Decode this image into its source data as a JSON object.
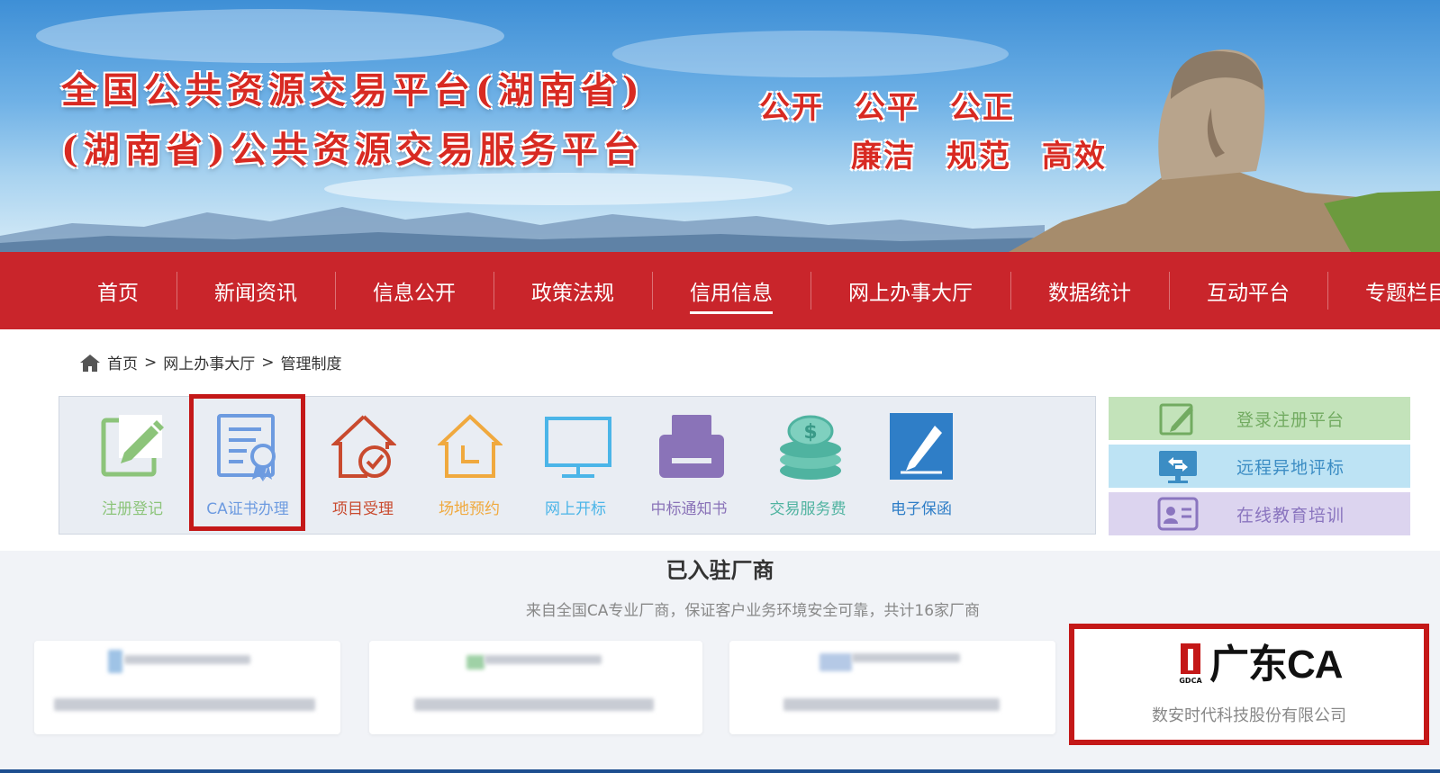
{
  "banner": {
    "title_line1": "全国公共资源交易平台(湖南省)",
    "title_line2": "(湖南省)公共资源交易服务平台",
    "slogan_line1": [
      "公开",
      "公平",
      "公正"
    ],
    "slogan_line2": [
      "廉洁",
      "规范",
      "高效"
    ]
  },
  "nav": {
    "items": [
      "首页",
      "新闻资讯",
      "信息公开",
      "政策法规",
      "信用信息",
      "网上办事大厅",
      "数据统计",
      "互动平台",
      "专题栏目"
    ],
    "active": "信用信息"
  },
  "breadcrumb": {
    "home": "首页",
    "sep1": ">",
    "level2": "网上办事大厅",
    "sep2": ">",
    "current": "管理制度"
  },
  "services": [
    {
      "label": "注册登记",
      "icon": "register-pencil-icon",
      "color": "#8cc47a"
    },
    {
      "label": "CA证书办理",
      "icon": "ca-certificate-icon",
      "color": "#6d9be0"
    },
    {
      "label": "项目受理",
      "icon": "house-check-icon",
      "color": "#c94a2e"
    },
    {
      "label": "场地预约",
      "icon": "house-l-icon",
      "color": "#f0a93e"
    },
    {
      "label": "网上开标",
      "icon": "monitor-icon",
      "color": "#4bb5e8"
    },
    {
      "label": "中标通知书",
      "icon": "printer-icon",
      "color": "#8a73b8"
    },
    {
      "label": "交易服务费",
      "icon": "coins-icon",
      "color": "#4fb3a0"
    },
    {
      "label": "电子保函",
      "icon": "pen-document-icon",
      "color": "#2f7ec7"
    }
  ],
  "quick_links": [
    {
      "label": "登录注册平台",
      "icon": "edit-icon",
      "bg": "#c3e3ba",
      "color": "#72ab61"
    },
    {
      "label": "远程异地评标",
      "icon": "remote-screen-icon",
      "bg": "#bde3f4",
      "color": "#3c8dc4"
    },
    {
      "label": "在线教育培训",
      "icon": "id-card-icon",
      "bg": "#dcd4ef",
      "color": "#8a75bf"
    }
  ],
  "vendors": {
    "title": "已入驻厂商",
    "subtitle": "来自全国CA专业厂商，保证客户业务环境安全可靠，共计16家厂商",
    "featured": {
      "logo_text": "广东CA",
      "logo_caption": "GDCA",
      "company": "数安时代科技股份有限公司"
    }
  }
}
